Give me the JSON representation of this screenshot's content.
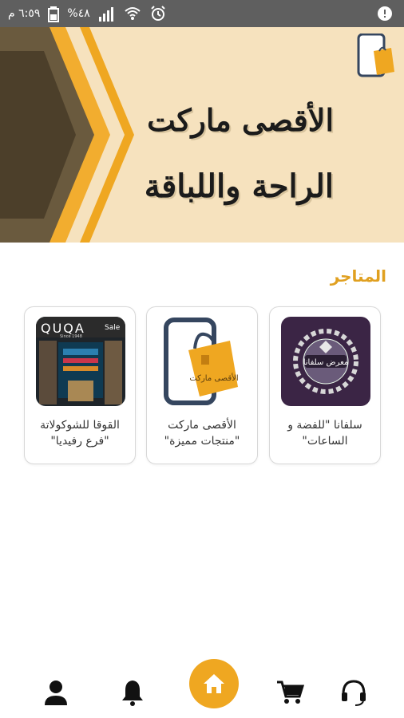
{
  "status_bar": {
    "time": "٦:٥٩ م",
    "battery": "%٤٨"
  },
  "banner": {
    "line1": "الأقصى ماركت",
    "line2": "الراحة واللباقة"
  },
  "section": {
    "title": "المتاجر"
  },
  "stores": [
    {
      "name": "سلفانا \"للفضة و الساعات\""
    },
    {
      "name": "الأقصى ماركت \"منتجات مميزة\""
    },
    {
      "name": "القوقا للشوكولاتة \"فرع رفيديا\""
    }
  ],
  "quqa_sign": {
    "brand": "QUQA",
    "sub": "Since 1948",
    "tag": "Sale"
  },
  "silvana_badge": "معرض سلفانا",
  "app_logo_text": "الأقصى ماركت",
  "colors": {
    "accent": "#efa721",
    "status_bar": "#5f5f5f",
    "banner_bg": "#f6e2be",
    "banner_dark": "#6a5a3e"
  },
  "bottom_nav": {
    "items": [
      "profile-icon",
      "bell-icon",
      "home-icon",
      "cart-icon",
      "headset-icon"
    ],
    "active": "home-icon"
  }
}
